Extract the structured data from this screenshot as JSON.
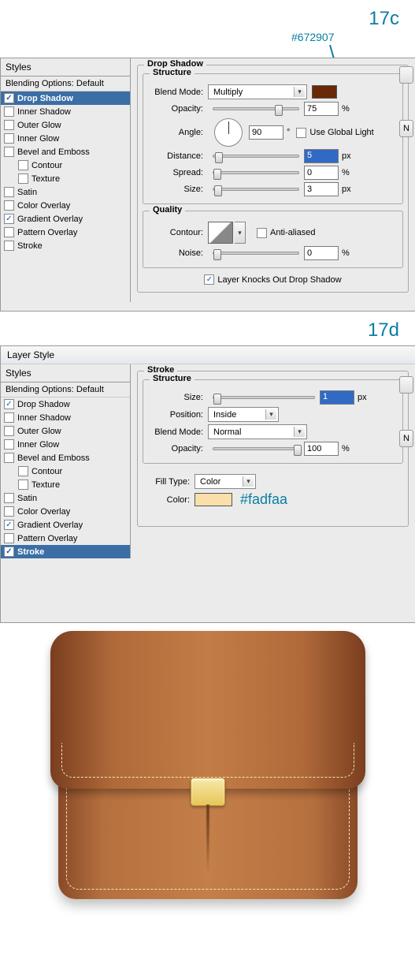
{
  "steps": {
    "c": "17c",
    "d": "17d"
  },
  "callout_hex": "#672907",
  "dialog_title": "Layer Style",
  "styles_header": "Styles",
  "blending_default": "Blending Options: Default",
  "style_items": [
    "Drop Shadow",
    "Inner Shadow",
    "Outer Glow",
    "Inner Glow",
    "Bevel and Emboss",
    "Contour",
    "Texture",
    "Satin",
    "Color Overlay",
    "Gradient Overlay",
    "Pattern Overlay",
    "Stroke"
  ],
  "panel_c": {
    "title": "Drop Shadow",
    "structure_label": "Structure",
    "blend_mode_label": "Blend Mode:",
    "blend_mode_value": "Multiply",
    "opacity_label": "Opacity:",
    "opacity_value": "75",
    "pct": "%",
    "angle_label": "Angle:",
    "angle_value": "90",
    "deg": "°",
    "use_global": "Use Global Light",
    "distance_label": "Distance:",
    "distance_value": "5",
    "spread_label": "Spread:",
    "spread_value": "0",
    "size_label": "Size:",
    "size_value": "3",
    "px": "px",
    "quality_label": "Quality",
    "contour_label": "Contour:",
    "anti_aliased": "Anti-aliased",
    "noise_label": "Noise:",
    "noise_value": "0",
    "knocks_out": "Layer Knocks Out Drop Shadow",
    "checked": {
      "drop_shadow": true,
      "gradient_overlay": true
    }
  },
  "panel_d": {
    "title": "Stroke",
    "structure_label": "Structure",
    "size_label": "Size:",
    "size_value": "1",
    "px": "px",
    "position_label": "Position:",
    "position_value": "Inside",
    "blend_mode_label": "Blend Mode:",
    "blend_mode_value": "Normal",
    "opacity_label": "Opacity:",
    "opacity_value": "100",
    "pct": "%",
    "fill_type_label": "Fill Type:",
    "fill_type_value": "Color",
    "color_label": "Color:",
    "color_hex": "#fadfaa",
    "color_swatch": "#fadfaa",
    "checked": {
      "drop_shadow": true,
      "gradient_overlay": true,
      "stroke": true
    }
  },
  "buttons": {
    "new_style": "N"
  }
}
